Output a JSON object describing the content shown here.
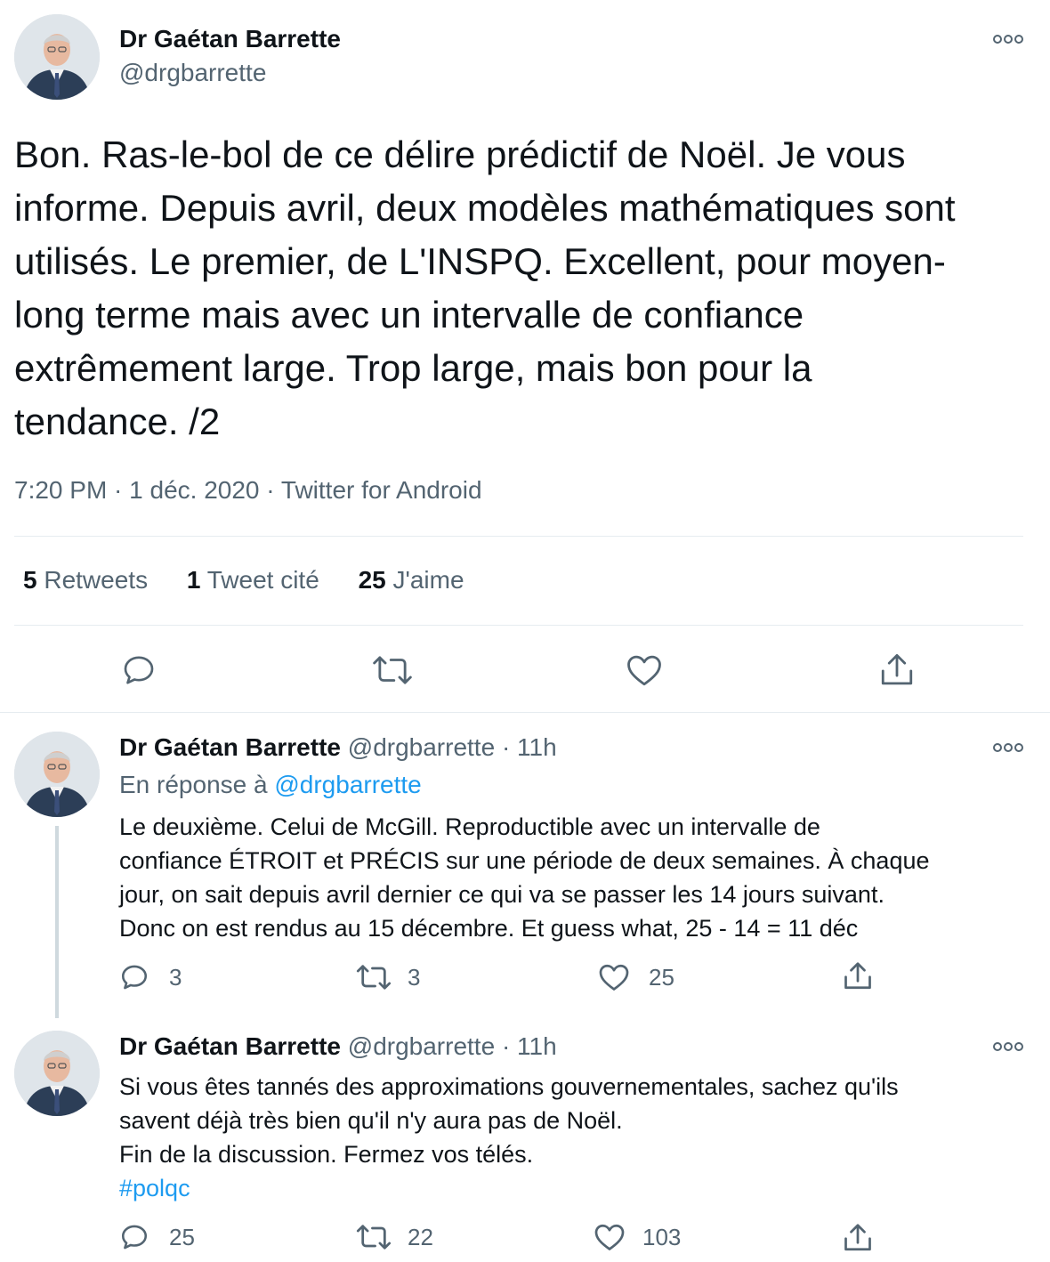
{
  "main_tweet": {
    "name": "Dr Gaétan Barrette",
    "handle": "@drgbarrette",
    "text_lines": [
      "Bon. Ras-le-bol de ce délire prédictif de Noël. Je vous",
      "informe. Depuis avril, deux modèles mathématiques sont",
      "utilisés. Le premier, de L'INSPQ. Excellent, pour moyen-",
      "long terme mais avec un intervalle de confiance",
      "extrêmement large. Trop large, mais bon pour la",
      "tendance. /2"
    ],
    "meta": "7:20 PM · 1 déc. 2020 · Twitter for Android",
    "stats": {
      "retweets_count": "5",
      "retweets_label": "Retweets",
      "quotes_count": "1",
      "quotes_label": "Tweet cité",
      "likes_count": "25",
      "likes_label": "J'aime"
    },
    "actions": [
      "reply-icon",
      "retweet-icon",
      "like-icon",
      "share-icon"
    ]
  },
  "replies": [
    {
      "name": "Dr Gaétan Barrette",
      "handle": "@drgbarrette",
      "time": "· 11h",
      "reply_to_prefix": "En réponse à",
      "reply_to_handle": "@drgbarrette",
      "text_lines": [
        "Le deuxième. Celui de McGill. Reproductible avec un intervalle de",
        "confiance ÉTROIT et PRÉCIS sur une période de deux semaines. À chaque",
        "jour, on sait depuis avril dernier ce qui va se passer les 14 jours suivant.",
        "Donc on est rendus au 15 décembre. Et guess what, 25 - 14 = 11 déc"
      ],
      "reply_count": "3",
      "retweet_count": "3",
      "like_count": "25"
    },
    {
      "name": "Dr Gaétan Barrette",
      "handle": "@drgbarrette",
      "time": "· 11h",
      "text_lines": [
        "Si vous êtes tannés des approximations gouvernementales, sachez qu'ils",
        "savent déjà très bien qu'il n'y aura pas de Noël.",
        "Fin de la discussion. Fermez vos télés."
      ],
      "hashtag": "#polqc",
      "reply_count": "25",
      "retweet_count": "22",
      "like_count": "103"
    }
  ],
  "colors": {
    "text": "#0f1419",
    "muted": "#536471",
    "link": "#1d9bf0",
    "divider": "#e6ecf0"
  }
}
